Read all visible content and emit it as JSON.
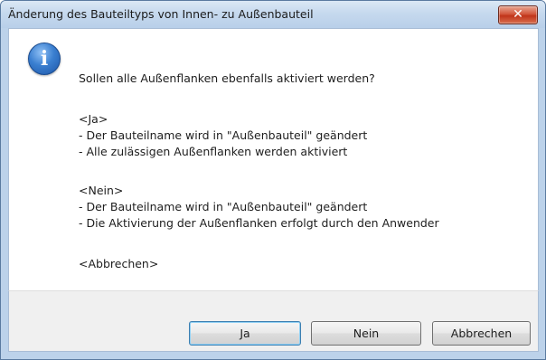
{
  "window": {
    "title": "Änderung des Bauteiltyps von Innen- zu Außenbauteil",
    "close_label": "✕"
  },
  "icon": "info-icon",
  "message": {
    "question": "Sollen alle Außenflanken ebenfalls aktiviert werden?",
    "lines": [
      "<Ja>",
      "- Der Bauteilname wird in \"Außenbauteil\" geändert",
      "- Alle zulässigen Außenflanken werden aktiviert",
      "<Nein>",
      "- Der Bauteilname wird in \"Außenbauteil\" geändert",
      "- Die Aktivierung der Außenflanken erfolgt durch den Anwender",
      "<Abbrechen>"
    ]
  },
  "buttons": {
    "yes": "Ja",
    "no": "Nein",
    "cancel": "Abbrechen"
  }
}
